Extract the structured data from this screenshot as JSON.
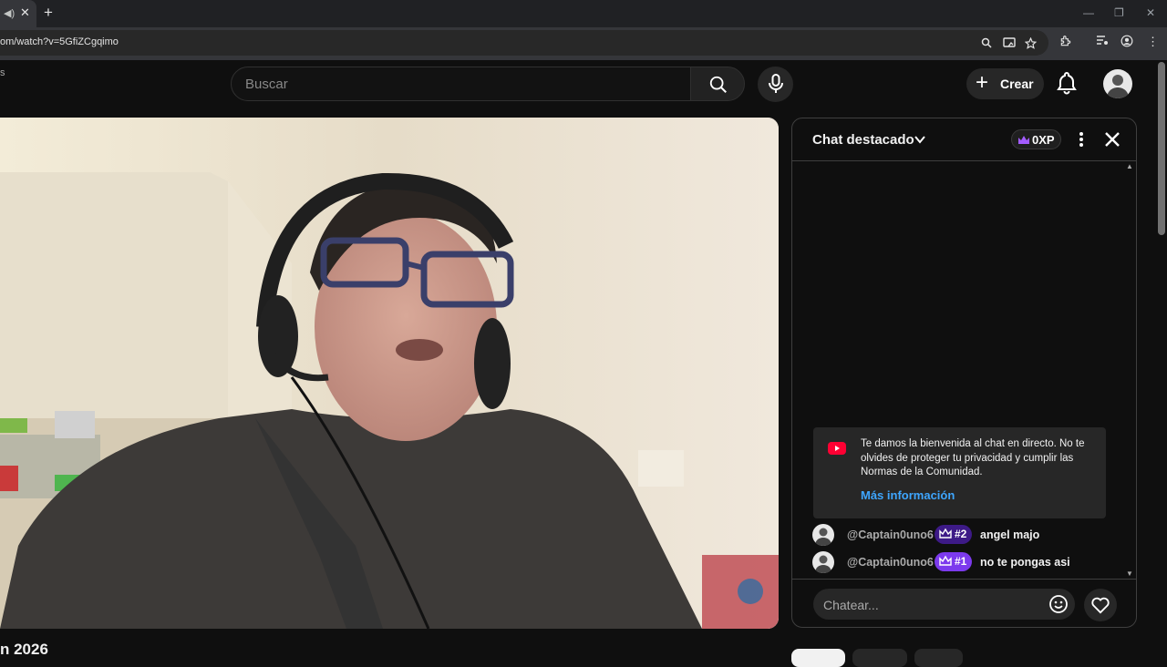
{
  "browser": {
    "url": "om/watch?v=5GfiZCgqimo"
  },
  "header": {
    "search_placeholder": "Buscar",
    "create_label": "Crear",
    "logo_partial": "s"
  },
  "video": {
    "title_partial": "n 2026"
  },
  "chat": {
    "title": "Chat destacado",
    "xp_label": "0XP",
    "welcome_text": "Te damos la bienvenida al chat en directo. No te olvides de proteger tu privacidad y cumplir las Normas de la Comunidad.",
    "welcome_link": "Más información",
    "messages": [
      {
        "author": "@Captain0uno6",
        "rank": "#2",
        "text": "angel majo",
        "rank_color": "#3d1a87"
      },
      {
        "author": "@Captain0uno6",
        "rank": "#1",
        "text": "no te pongas asi",
        "rank_color": "#7c3aed"
      }
    ],
    "input_placeholder": "Chatear..."
  },
  "colors": {
    "accent_link": "#3ea6ff",
    "youtube_red": "#ff0033"
  }
}
